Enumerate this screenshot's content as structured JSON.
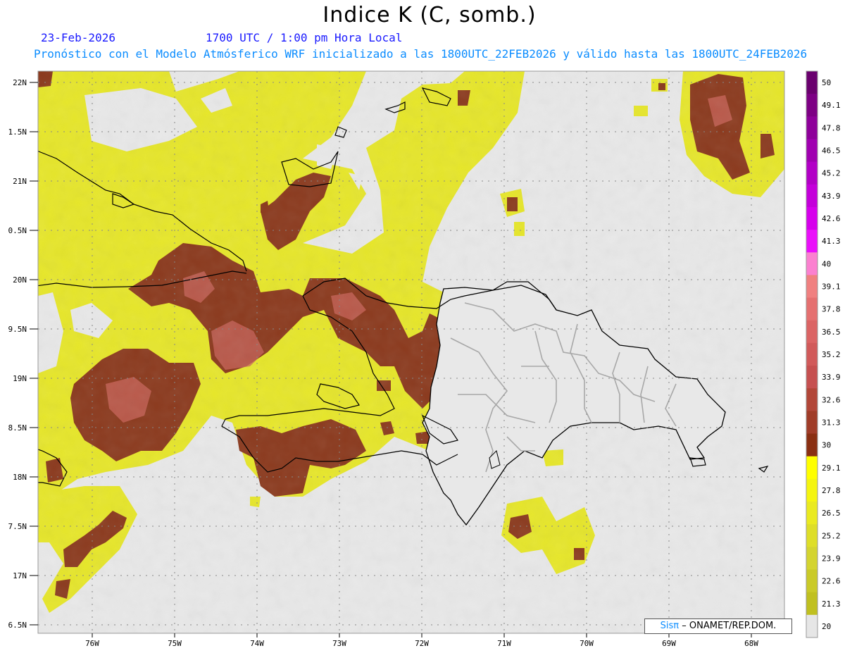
{
  "title": "Indice K (C, somb.)",
  "header": {
    "date": "23-Feb-2026",
    "time": "1700 UTC / 1:00 pm Hora Local",
    "model_info": "Pronóstico con el Modelo Atmósferico WRF inicializado a las 1800UTC_22FEB2026 y válido hasta las  1800UTC_24FEB2026"
  },
  "axes": {
    "lat_labels": [
      "22N",
      "1.5N",
      "21N",
      "0.5N",
      "20N",
      "9.5N",
      "19N",
      "8.5N",
      "18N",
      "7.5N",
      "17N",
      "6.5N"
    ],
    "lon_labels": [
      "76W",
      "75W",
      "74W",
      "73W",
      "72W",
      "71W",
      "70W",
      "69W",
      "68W"
    ]
  },
  "colorbar": {
    "labels": [
      "50",
      "49.1",
      "47.8",
      "46.5",
      "45.2",
      "43.9",
      "42.6",
      "41.3",
      "40",
      "39.1",
      "37.8",
      "36.5",
      "35.2",
      "33.9",
      "32.6",
      "31.3",
      "30",
      "29.1",
      "27.8",
      "26.5",
      "25.2",
      "23.9",
      "22.6",
      "21.3",
      "20"
    ],
    "colors": [
      "#6a006e",
      "#7d0084",
      "#8e009a",
      "#a000b0",
      "#b200c6",
      "#c400da",
      "#d600ec",
      "#ea10fa",
      "#fb80d0",
      "#f08080",
      "#e57070",
      "#db6464",
      "#d15a5a",
      "#c65050",
      "#b24638",
      "#a03c28",
      "#8a2f12",
      "#ffff00",
      "#f5f510",
      "#eaea20",
      "#dede28",
      "#d4d430",
      "#caca28",
      "#c0c020",
      "#e6e6e6"
    ]
  },
  "colors": {
    "ocean_background": "#e8e8e8",
    "moderate": "#e8e82a",
    "high": "#8b3a1e",
    "very_high": "#c8645a"
  },
  "credit": {
    "sis": "Sisπ",
    "text": "– ONAMET/REP.DOM."
  }
}
